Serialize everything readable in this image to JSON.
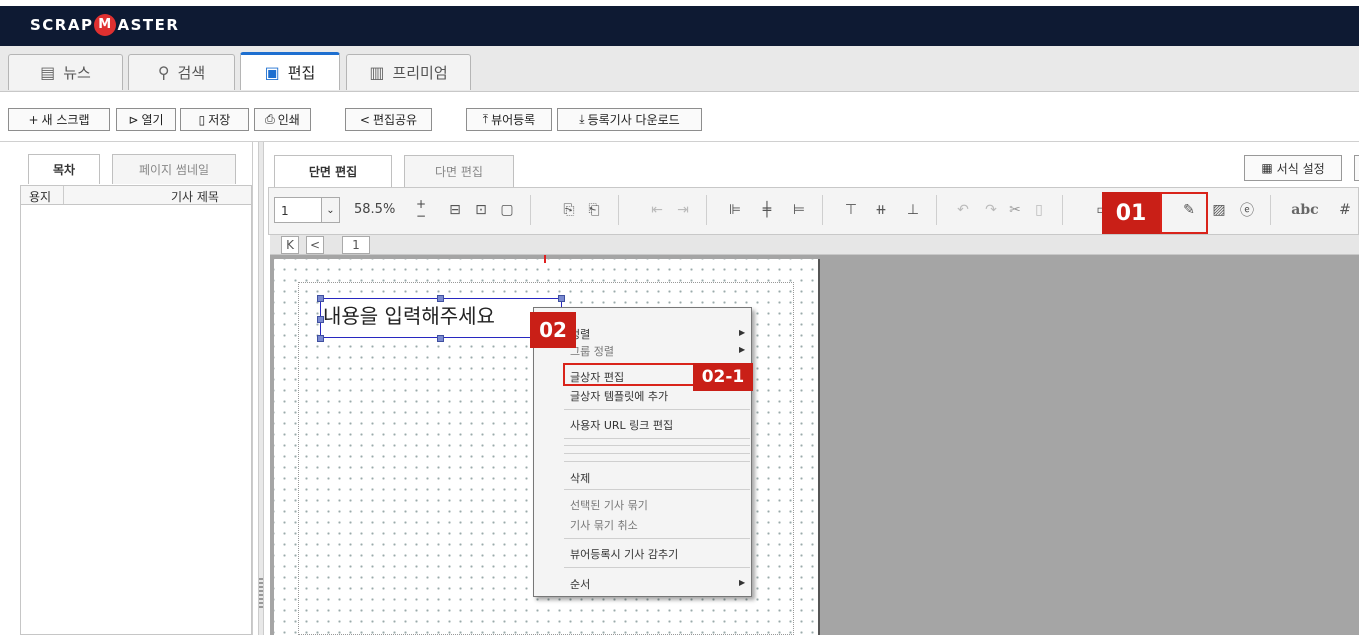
{
  "app": {
    "logo_left": "SCRAP",
    "logo_m": "M",
    "logo_right": "ASTER"
  },
  "main_tabs": [
    {
      "label": "뉴스",
      "icon": "newspaper-icon"
    },
    {
      "label": "검색",
      "icon": "search-icon"
    },
    {
      "label": "편집",
      "icon": "clipboard-icon",
      "active": true
    },
    {
      "label": "프리미엄",
      "icon": "chart-icon"
    }
  ],
  "toolbar": {
    "new_scrap": "새 스크랩",
    "open": "열기",
    "save": "저장",
    "print": "인쇄",
    "share": "편집공유",
    "viewer_register": "뷰어등록",
    "download": "등록기사 다운로드"
  },
  "left_panel": {
    "tabs": [
      "목차",
      "페이지 썸네일"
    ],
    "col1": "용지",
    "col2": "기사 제목"
  },
  "right_panel": {
    "tabs": [
      "단면 편집",
      "다면 편집"
    ],
    "format_settings": "서식 설정",
    "page_select": "1",
    "zoom": "58.5%",
    "page_number": "1",
    "page_nav_first": "K",
    "page_nav_prev": "<",
    "abc_label": "abc"
  },
  "canvas": {
    "textbox_text": "내용을 입력해주세요"
  },
  "context_menu": {
    "items": [
      {
        "label": "정렬",
        "submenu": true
      },
      {
        "label": "그룹 정렬",
        "submenu": true,
        "disabled": true
      },
      {
        "label": "글상자 편집"
      },
      {
        "label": "글상자 템플릿에 추가"
      },
      {
        "label": "사용자 URL 링크 편집"
      },
      {
        "label": "삭제"
      },
      {
        "label": "선택된 기사 묶기",
        "disabled": true
      },
      {
        "label": "기사 묶기 취소",
        "disabled": true
      },
      {
        "label": "뷰어등록시 기사 감추기"
      },
      {
        "label": "순서",
        "submenu": true
      }
    ]
  },
  "annotations": {
    "step1": "01",
    "step2": "02",
    "step2_1": "02-1"
  },
  "colors": {
    "topbar": "#0e1a33",
    "accent": "#1e6fd0",
    "annotation_red": "#c91f17",
    "logo_circle": "#e03030"
  }
}
